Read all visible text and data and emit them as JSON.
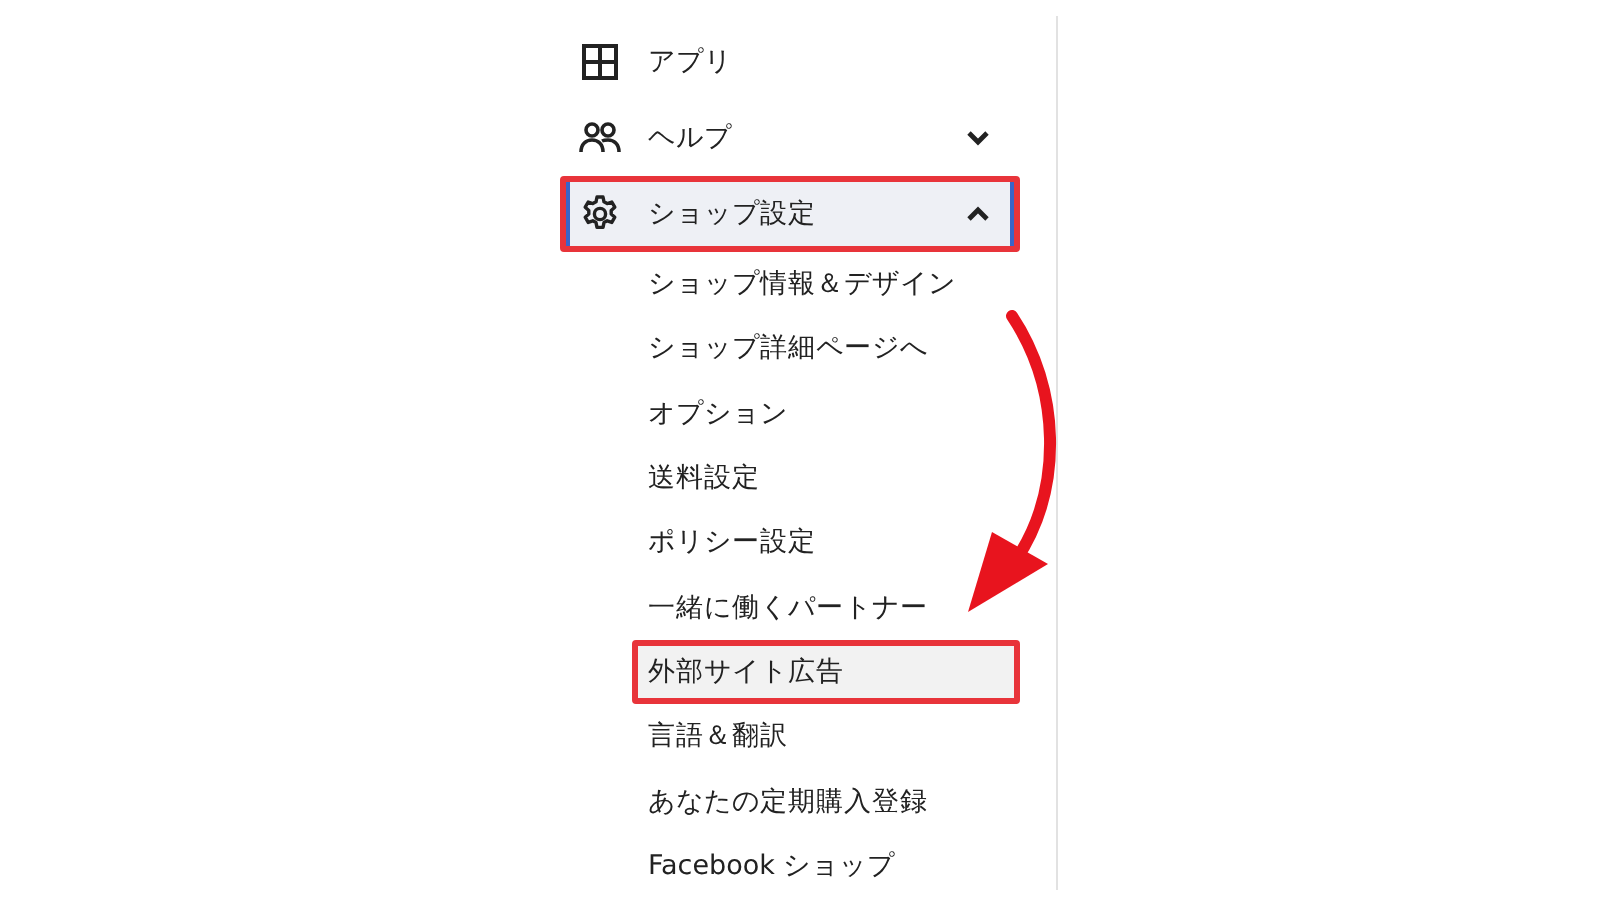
{
  "menu": [
    {
      "label": "アプリ",
      "kind": "link",
      "selected": false,
      "highlighted": false
    },
    {
      "label": "ヘルプ",
      "kind": "group",
      "expanded": false,
      "selected": false,
      "highlighted": false
    },
    {
      "label": "ショップ設定",
      "kind": "group",
      "expanded": true,
      "selected": true,
      "highlighted": true,
      "children": [
        {
          "label": "ショップ情報＆デザイン",
          "selected": false,
          "highlighted": false
        },
        {
          "label": "ショップ詳細ページへ",
          "selected": false,
          "highlighted": false
        },
        {
          "label": "オプション",
          "selected": false,
          "highlighted": false
        },
        {
          "label": "送料設定",
          "selected": false,
          "highlighted": false
        },
        {
          "label": "ポリシー設定",
          "selected": false,
          "highlighted": false
        },
        {
          "label": "一緒に働くパートナー",
          "selected": false,
          "highlighted": false
        },
        {
          "label": "外部サイト広告",
          "selected": true,
          "highlighted": true
        },
        {
          "label": "言語＆翻訳",
          "selected": false,
          "highlighted": false
        },
        {
          "label": "あなたの定期購入登録",
          "selected": false,
          "highlighted": false
        },
        {
          "label": "Facebook ショップ",
          "selected": false,
          "highlighted": false
        }
      ]
    }
  ]
}
